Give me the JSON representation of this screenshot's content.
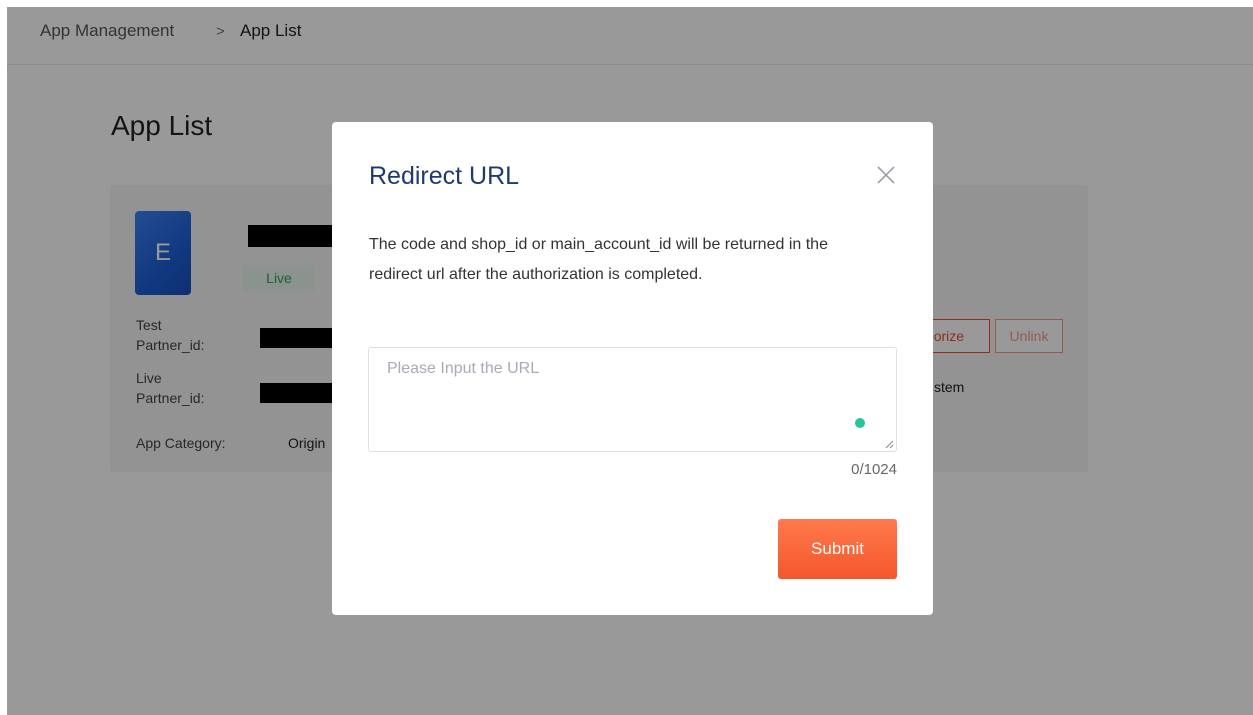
{
  "breadcrumb": {
    "parent": "App Management",
    "separator": ">",
    "current": "App List"
  },
  "page": {
    "title": "App List"
  },
  "app": {
    "logo_letter": "E",
    "status": "Live",
    "test_partner_label": "Test\nPartner_id:",
    "live_partner_label": "Live\nPartner_id:",
    "category_label": "App Category:",
    "category_value_partial": "Origin",
    "authorize_partial": "horize",
    "unlink_label": "Unlink",
    "side_text_partial": "stem"
  },
  "modal": {
    "title": "Redirect URL",
    "description": "The code and shop_id or main_account_id will be returned in the redirect url after the authorization is completed.",
    "input_placeholder": "Please Input the URL",
    "input_value": "",
    "counter": "0/1024",
    "submit_label": "Submit"
  },
  "colors": {
    "accent": "#ee4d2d",
    "submit_gradient_top": "#ff7a4d",
    "submit_gradient_bottom": "#f4572b",
    "title_color": "#1f3b6e",
    "live_tag_bg": "#e7f6ec",
    "live_tag_text": "#2f9e5b",
    "status_dot": "#26c59a"
  },
  "icons": {
    "close": "close-icon",
    "resize": "resize-handle-icon",
    "status": "status-dot-icon"
  }
}
